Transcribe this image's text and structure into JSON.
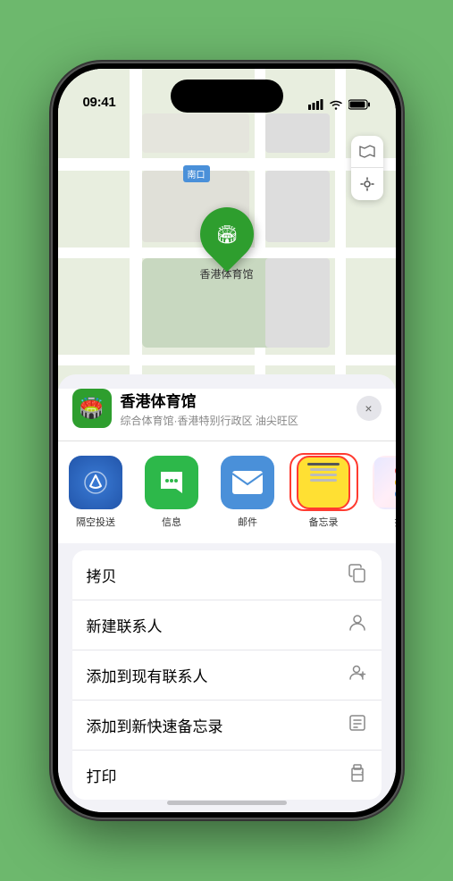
{
  "status": {
    "time": "09:41",
    "location_icon": "◀"
  },
  "map": {
    "label_text": "南口",
    "venue_pin_label": "香港体育馆"
  },
  "venue": {
    "name": "香港体育馆",
    "subtitle": "综合体育馆·香港特别行政区 油尖旺区",
    "icon": "🏟️"
  },
  "share_apps": [
    {
      "id": "airdrop",
      "label": "隔空投送"
    },
    {
      "id": "messages",
      "label": "信息"
    },
    {
      "id": "mail",
      "label": "邮件"
    },
    {
      "id": "notes",
      "label": "备忘录",
      "highlighted": true
    },
    {
      "id": "more",
      "label": "推"
    }
  ],
  "actions": [
    {
      "label": "拷贝",
      "icon": "copy"
    },
    {
      "label": "新建联系人",
      "icon": "person"
    },
    {
      "label": "添加到现有联系人",
      "icon": "person-add"
    },
    {
      "label": "添加到新快速备忘录",
      "icon": "notes2"
    },
    {
      "label": "打印",
      "icon": "printer"
    }
  ],
  "close_label": "×"
}
